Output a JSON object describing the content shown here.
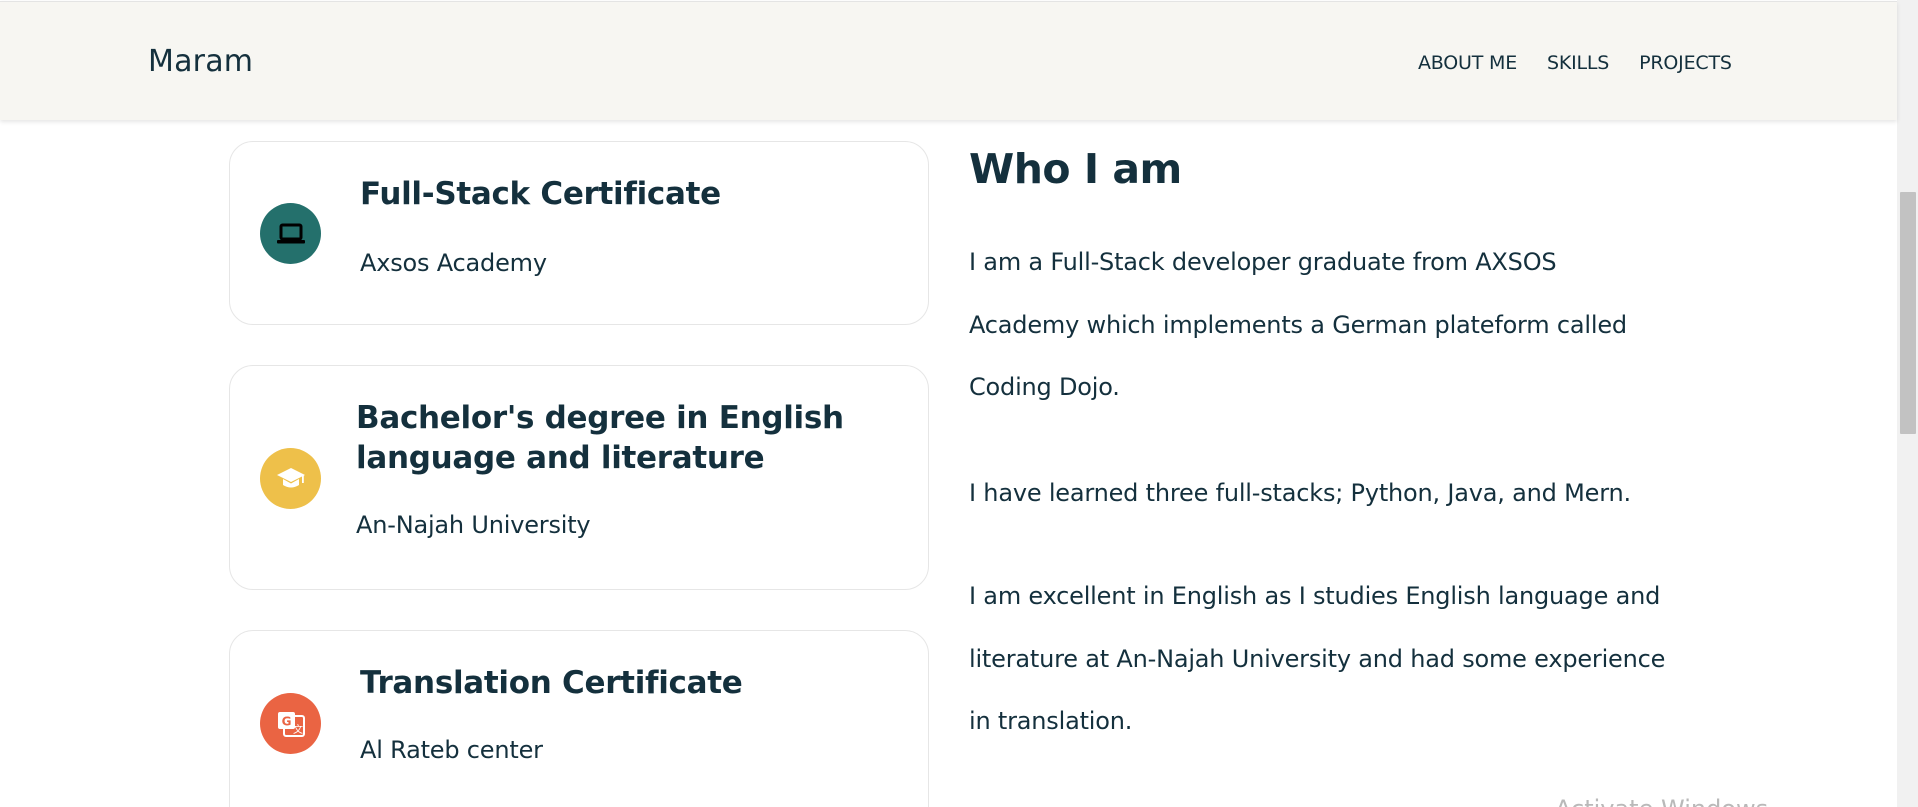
{
  "navbar": {
    "brand": "Maram",
    "links": [
      "ABOUT ME",
      "SKILLS",
      "PROJECTS"
    ]
  },
  "cards": [
    {
      "title": "Full-Stack Certificate",
      "subtitle": "Axsos Academy",
      "icon": "laptop-icon",
      "color": "#24706c"
    },
    {
      "title": "Bachelor's degree in English language and literature",
      "subtitle": "An-Najah University",
      "icon": "graduation-cap-icon",
      "color": "#eec04a"
    },
    {
      "title": "Translation Certificate",
      "subtitle": "Al Rateb center",
      "icon": "translate-icon",
      "color": "#ea6443"
    }
  ],
  "about": {
    "title": "Who I am",
    "paragraphs": [
      "I am a Full-Stack developer graduate from AXSOS Academy which implements a German plateform called Coding Dojo.",
      "I have learned three full-stacks; Python, Java, and Mern.",
      "I am excellent in English as I studies English language and literature at An-Najah University and had some experience in translation."
    ]
  },
  "watermark": "Activate Windows"
}
